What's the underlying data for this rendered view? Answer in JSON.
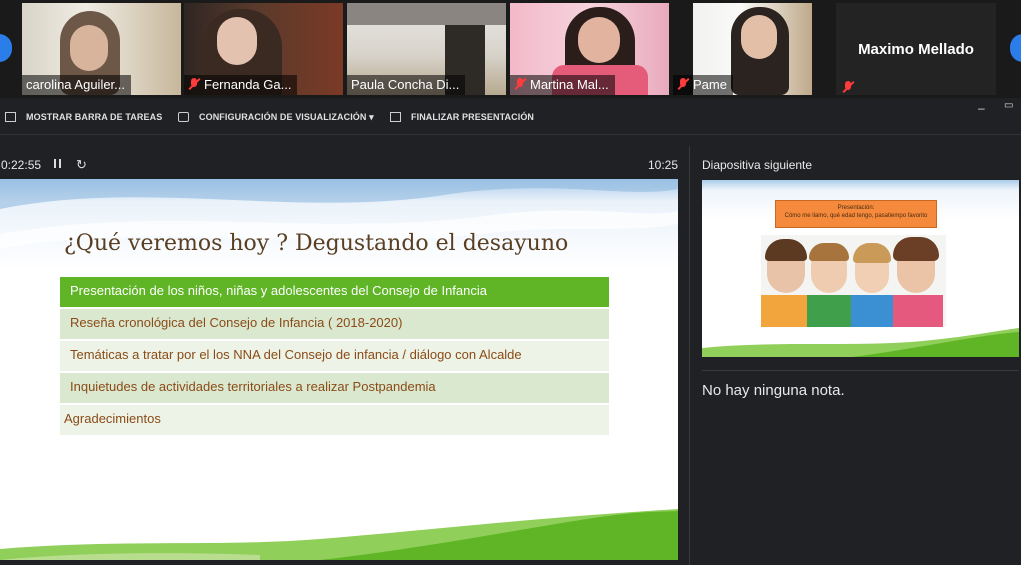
{
  "participants": [
    {
      "name": "carolina Aguiler...",
      "muted": false
    },
    {
      "name": "Fernanda Ga...",
      "muted": true
    },
    {
      "name": "Paula Concha Di...",
      "muted": false
    },
    {
      "name": "Martina Mal...",
      "muted": true
    },
    {
      "name": "Pame",
      "muted": true
    },
    {
      "name": "Maximo Mellado",
      "muted": true
    }
  ],
  "toolbar": {
    "taskbar_label": "MOSTRAR BARRA DE TAREAS",
    "display_settings_label": "CONFIGURACIÓN DE VISUALIZACIÓN ▾",
    "end_presentation_label": "FINALIZAR PRESENTACIÓN",
    "minimize_label": "–",
    "restore_label": "▭"
  },
  "presenter": {
    "elapsed": "0:22:55",
    "clock": "10:25",
    "next_slide_label": "Diapositiva siguiente",
    "notes": "No hay ninguna nota."
  },
  "slide": {
    "title": "¿Qué veremos hoy ? Degustando el desayuno",
    "items": [
      "Presentación de los niños, niñas y adolescentes del Consejo de Infancia",
      "Reseña cronológica del Consejo de Infancia ( 2018-2020)",
      "Temáticas a tratar por el  los NNA del Consejo de infancia / diálogo con Alcalde",
      "Inquietudes de actividades territoriales a realizar Postpandemia",
      "Agradecimientos"
    ]
  },
  "next_slide": {
    "heading": "Presentación:",
    "subheading": "Cómo me llamo, qué edad tengo, pasatiempo favorito"
  },
  "colors": {
    "accent_blue": "#2b7de9",
    "highlight_green": "#5fb526",
    "row_green_light": "#dbe8d0",
    "row_green_lighter": "#edf3e7",
    "slide_text_brown": "#8a4b17",
    "mute_red": "#ff3b3b",
    "orange_box": "#f58a3c"
  }
}
